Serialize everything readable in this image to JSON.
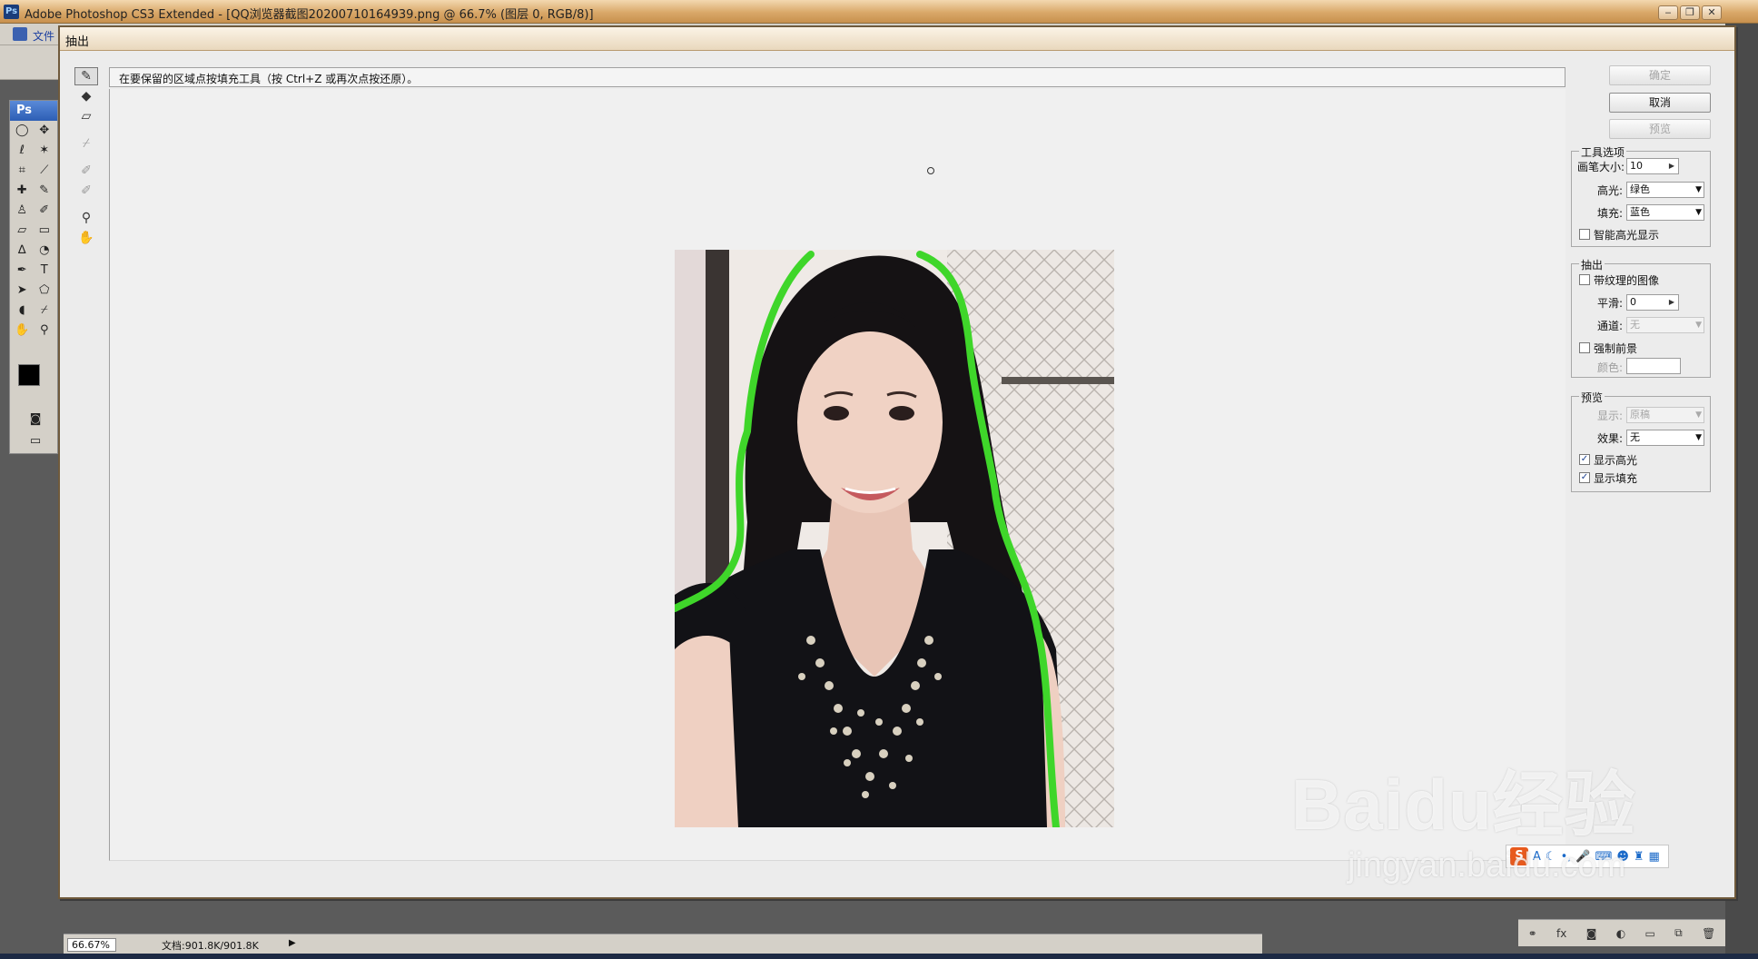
{
  "app": {
    "title": "Adobe Photoshop CS3 Extended - [QQ浏览器截图20200710164939.png @ 66.7% (图层 0, RGB/8)]",
    "logo": "Ps",
    "menu_file": "文件",
    "toolbox_label": "Ps",
    "zoom": "66.67%",
    "doc_size": "文档:901.8K/901.8K"
  },
  "dialog": {
    "title": "抽出",
    "instruction": "在要保留的区域点按填充工具（按 Ctrl+Z 或再次点按还原）。",
    "buttons": {
      "ok": "确定",
      "cancel": "取消",
      "preview": "预览"
    },
    "tool_options": {
      "legend": "工具选项",
      "brush_size_label": "画笔大小:",
      "brush_size_value": "10",
      "highlight_label": "高光:",
      "highlight_value": "绿色",
      "fill_label": "填充:",
      "fill_value": "蓝色",
      "smart_highlight_label": "智能高光显示"
    },
    "extraction": {
      "legend": "抽出",
      "textured_label": "带纹理的图像",
      "smooth_label": "平滑:",
      "smooth_value": "0",
      "channel_label": "通道:",
      "channel_value": "无",
      "force_fg_label": "强制前景",
      "color_label": "颜色:"
    },
    "preview": {
      "legend": "预览",
      "show_label": "显示:",
      "show_value": "原稿",
      "effect_label": "效果:",
      "effect_value": "无",
      "show_highlight_label": "显示高光",
      "show_highlight_checked": true,
      "show_fill_label": "显示填充",
      "show_fill_checked": true
    },
    "tools": [
      "edge-highlighter-icon",
      "fill-bucket-icon",
      "eraser-icon",
      "eyedropper-icon",
      "cleanup-icon",
      "edge-touchup-icon",
      "zoom-icon",
      "hand-icon"
    ]
  },
  "watermark": {
    "text": "Baidu经验",
    "url": "jingyan.baidu.com"
  },
  "colors": {
    "highlight": "#3fd62a",
    "dialog_bg": "#ececec",
    "titlebar": "#d9a869"
  }
}
